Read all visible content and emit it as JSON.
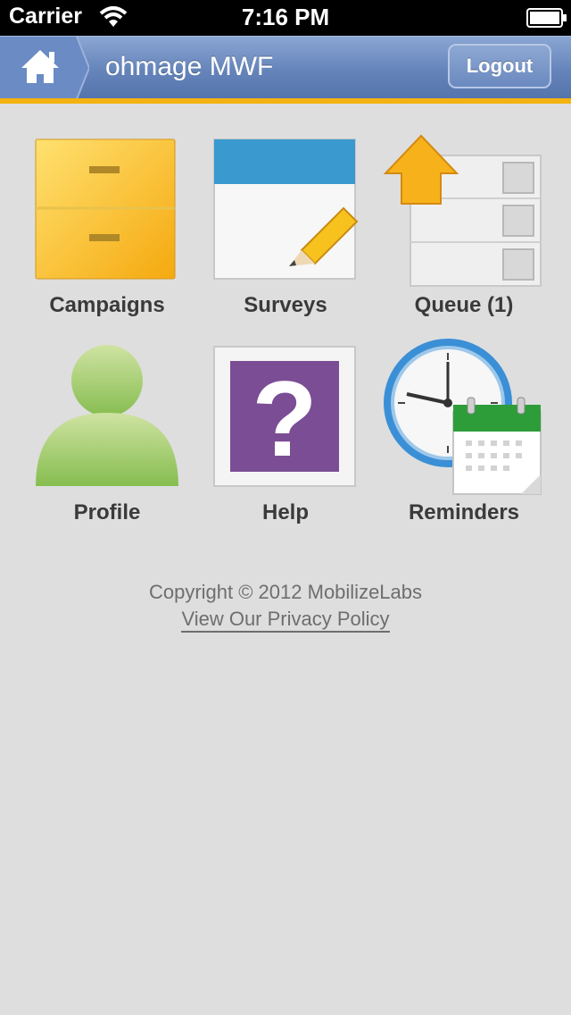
{
  "status_bar": {
    "carrier": "Carrier",
    "time": "7:16 PM"
  },
  "nav": {
    "title": "ohmage MWF",
    "logout_label": "Logout",
    "accent_color": "#f3b20f",
    "bar_color": "#6584ba"
  },
  "tiles": [
    {
      "label": "Campaigns",
      "icon": "campaigns-cabinet-icon"
    },
    {
      "label": "Surveys",
      "icon": "surveys-notepad-icon"
    },
    {
      "label": "Queue (1)",
      "icon": "queue-upload-icon"
    },
    {
      "label": "Profile",
      "icon": "profile-person-icon"
    },
    {
      "label": "Help",
      "icon": "help-question-icon"
    },
    {
      "label": "Reminders",
      "icon": "reminders-clock-calendar-icon"
    }
  ],
  "footer": {
    "copyright": "Copyright © 2012 MobilizeLabs",
    "privacy_link": "View Our Privacy Policy"
  }
}
